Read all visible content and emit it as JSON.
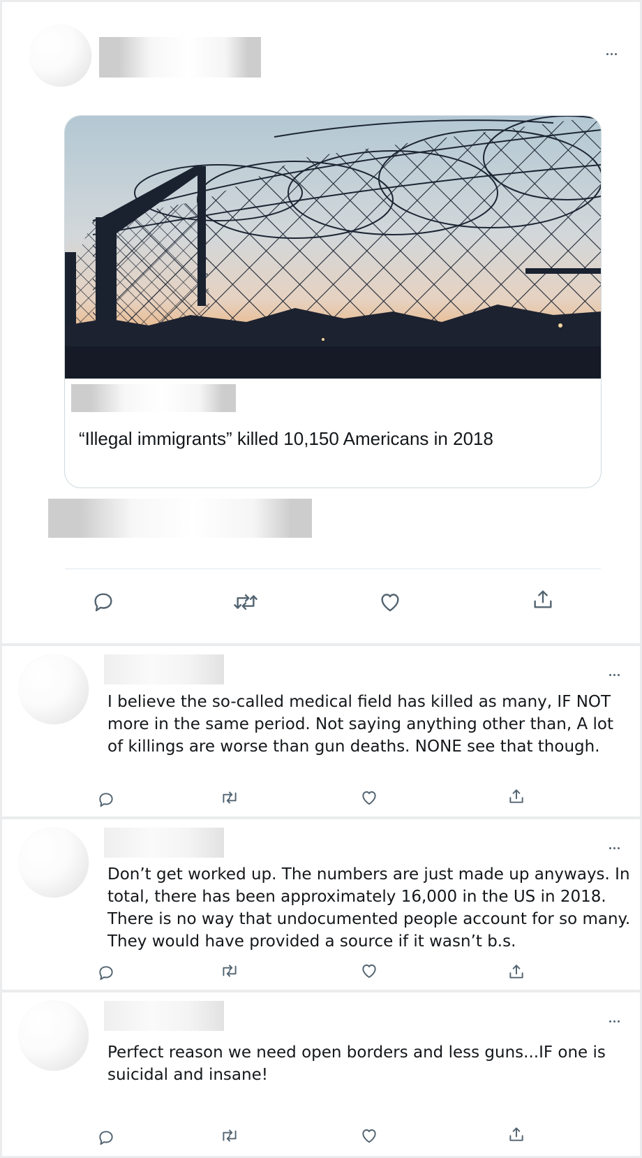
{
  "tweet": {
    "link_card": {
      "headline": "“Illegal immigrants” killed 10,150 Americans in 2018"
    },
    "actions": [
      "reply-icon",
      "retweet-icon",
      "like-icon",
      "share-icon"
    ]
  },
  "replies": [
    {
      "text": "I believe the so-called medical field has killed as many, IF NOT more in the same period. Not saying anything other than, A lot of killings are worse than gun deaths. NONE see that though."
    },
    {
      "text": "Don’t get worked up. The numbers are just made up anyways. In total, there has been approximately 16,000 in the US in 2018. There is no way that undocumented people account for so many. They would have provided a source if it wasn’t b.s."
    },
    {
      "text": "Perfect reason we need open borders and less guns...IF one is suicidal and insane!"
    }
  ],
  "colors": {
    "icon": "#536471",
    "text": "#14171a",
    "border": "#cfd9de"
  }
}
